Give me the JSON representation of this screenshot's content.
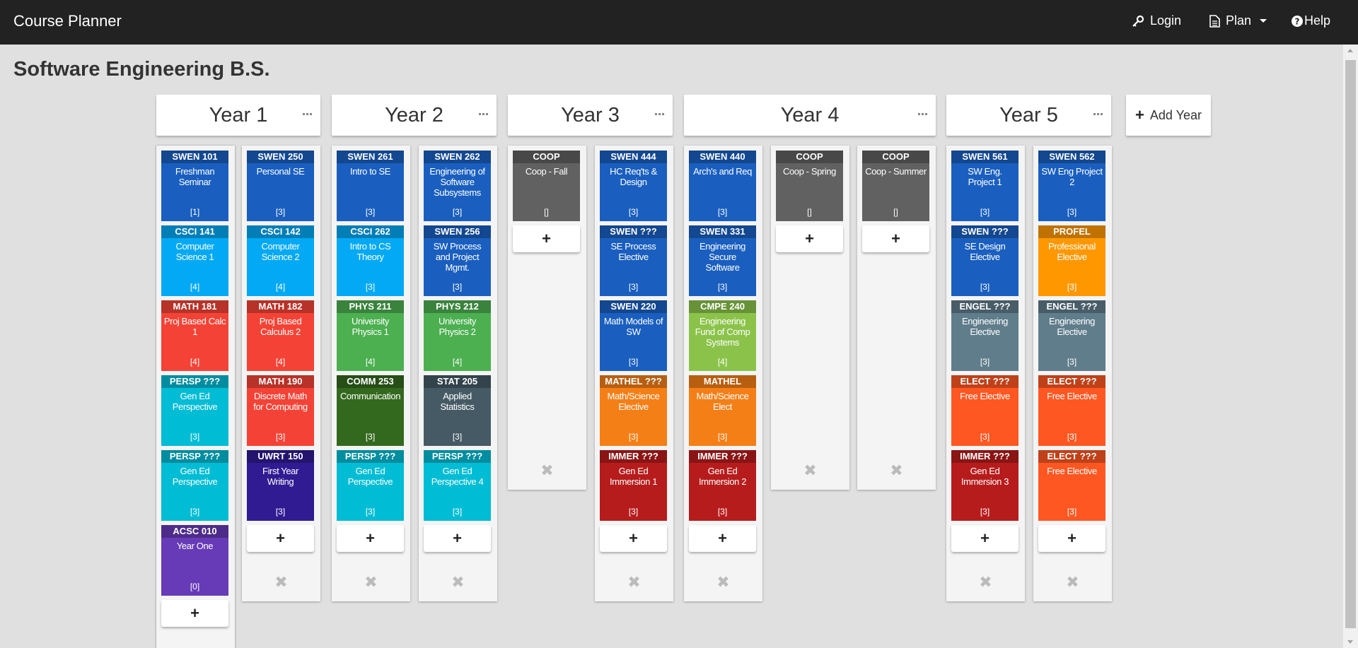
{
  "navbar": {
    "brand": "Course Planner",
    "login_label": "Login",
    "plan_label": "Plan",
    "help_label": "Help"
  },
  "page": {
    "title": "Software Engineering B.S."
  },
  "years": [
    {
      "label": "Year 1"
    },
    {
      "label": "Year 2"
    },
    {
      "label": "Year 3"
    },
    {
      "label": "Year 4"
    },
    {
      "label": "Year 5"
    }
  ],
  "add_year_label": "Add Year",
  "add_course_symbol": "+",
  "remove_symbol": "✖",
  "semesters": [
    {
      "courses": [
        {
          "code": "SWEN 101",
          "name": "Freshman Seminar",
          "credits": "[1]",
          "color": "#1a5fbf"
        },
        {
          "code": "CSCI 141",
          "name": "Computer Science 1",
          "credits": "[4]",
          "color": "#03a9f4"
        },
        {
          "code": "MATH 181",
          "name": "Proj Based Calc 1",
          "credits": "[4]",
          "color": "#f44336"
        },
        {
          "code": "PERSP ???",
          "name": "Gen Ed Perspective",
          "credits": "[3]",
          "color": "#00bcd4"
        },
        {
          "code": "PERSP ???",
          "name": "Gen Ed Perspective",
          "credits": "[3]",
          "color": "#00bcd4"
        },
        {
          "code": "ACSC 010",
          "name": "Year One",
          "credits": "[0]",
          "color": "#673ab7"
        }
      ]
    },
    {
      "courses": [
        {
          "code": "SWEN 250",
          "name": "Personal SE",
          "credits": "[3]",
          "color": "#1a5fbf"
        },
        {
          "code": "CSCI 142",
          "name": "Computer Science 2",
          "credits": "[4]",
          "color": "#03a9f4"
        },
        {
          "code": "MATH 182",
          "name": "Proj Based Calculus 2",
          "credits": "[4]",
          "color": "#f44336"
        },
        {
          "code": "MATH 190",
          "name": "Discrete Math for Computing",
          "credits": "[3]",
          "color": "#f44336"
        },
        {
          "code": "UWRT 150",
          "name": "First Year Writing",
          "credits": "[3]",
          "color": "#311b92"
        }
      ]
    },
    {
      "courses": [
        {
          "code": "SWEN 261",
          "name": "Intro to SE",
          "credits": "[3]",
          "color": "#1a5fbf"
        },
        {
          "code": "CSCI 262",
          "name": "Intro to CS Theory",
          "credits": "[3]",
          "color": "#03a9f4"
        },
        {
          "code": "PHYS 211",
          "name": "University Physics 1",
          "credits": "[4]",
          "color": "#4caf50"
        },
        {
          "code": "COMM 253",
          "name": "Communication",
          "credits": "[3]",
          "color": "#33691e"
        },
        {
          "code": "PERSP ???",
          "name": "Gen Ed Perspective",
          "credits": "[3]",
          "color": "#00bcd4"
        }
      ]
    },
    {
      "courses": [
        {
          "code": "SWEN 262",
          "name": "Engineering of Software Subsystems",
          "credits": "[3]",
          "color": "#1a5fbf"
        },
        {
          "code": "SWEN 256",
          "name": "SW Process and Project Mgmt.",
          "credits": "[3]",
          "color": "#1a5fbf"
        },
        {
          "code": "PHYS 212",
          "name": "University Physics 2",
          "credits": "[4]",
          "color": "#4caf50"
        },
        {
          "code": "STAT 205",
          "name": "Applied Statistics",
          "credits": "[3]",
          "color": "#455a64"
        },
        {
          "code": "PERSP ???",
          "name": "Gen Ed Perspective 4",
          "credits": "[3]",
          "color": "#00bcd4"
        }
      ]
    },
    {
      "courses": [
        {
          "code": "COOP",
          "name": "Coop - Fall",
          "credits": "[]",
          "color": "#616161"
        }
      ]
    },
    {
      "courses": [
        {
          "code": "SWEN 444",
          "name": "HC Req'ts & Design",
          "credits": "[3]",
          "color": "#1a5fbf"
        },
        {
          "code": "SWEN ???",
          "name": "SE Process Elective",
          "credits": "[3]",
          "color": "#1a5fbf"
        },
        {
          "code": "SWEN 220",
          "name": "Math Models of SW",
          "credits": "[3]",
          "color": "#1a5fbf"
        },
        {
          "code": "MATHEL ???",
          "name": "Math/Science Elective",
          "credits": "[3]",
          "color": "#f57f17"
        },
        {
          "code": "IMMER ???",
          "name": "Gen Ed Immersion 1",
          "credits": "[3]",
          "color": "#b71c1c"
        }
      ]
    },
    {
      "courses": [
        {
          "code": "SWEN 440",
          "name": "Arch's and Req",
          "credits": "[3]",
          "color": "#1a5fbf"
        },
        {
          "code": "SWEN 331",
          "name": "Engineering Secure Software",
          "credits": "[3]",
          "color": "#1a5fbf"
        },
        {
          "code": "CMPE 240",
          "name": "Engineering Fund of Comp Systems",
          "credits": "[4]",
          "color": "#8bc34a"
        },
        {
          "code": "MATHEL",
          "name": "Math/Science Elect",
          "credits": "[3]",
          "color": "#f57f17"
        },
        {
          "code": "IMMER ???",
          "name": "Gen Ed Immersion 2",
          "credits": "[3]",
          "color": "#b71c1c"
        }
      ]
    },
    {
      "courses": [
        {
          "code": "COOP",
          "name": "Coop - Spring",
          "credits": "[]",
          "color": "#616161"
        }
      ]
    },
    {
      "courses": [
        {
          "code": "COOP",
          "name": "Coop - Summer",
          "credits": "[]",
          "color": "#616161"
        }
      ]
    },
    {
      "courses": [
        {
          "code": "SWEN 561",
          "name": "SW Eng. Project 1",
          "credits": "[3]",
          "color": "#1a5fbf"
        },
        {
          "code": "SWEN ???",
          "name": "SE Design Elective",
          "credits": "[3]",
          "color": "#1a5fbf"
        },
        {
          "code": "ENGEL ???",
          "name": "Engineering Elective",
          "credits": "[3]",
          "color": "#607d8b"
        },
        {
          "code": "ELECT ???",
          "name": "Free Elective",
          "credits": "[3]",
          "color": "#ff5722"
        },
        {
          "code": "IMMER ???",
          "name": "Gen Ed Immersion 3",
          "credits": "[3]",
          "color": "#b71c1c"
        }
      ]
    },
    {
      "courses": [
        {
          "code": "SWEN 562",
          "name": "SW Eng Project 2",
          "credits": "[3]",
          "color": "#1a5fbf"
        },
        {
          "code": "PROFEL",
          "name": "Professional Elective",
          "credits": "[3]",
          "color": "#ff9800"
        },
        {
          "code": "ENGEL ???",
          "name": "Engineering Elective",
          "credits": "[3]",
          "color": "#607d8b"
        },
        {
          "code": "ELECT ???",
          "name": "Free Elective",
          "credits": "[3]",
          "color": "#ff5722"
        },
        {
          "code": "ELECT ???",
          "name": "Free Elective",
          "credits": "[3]",
          "color": "#ff5722"
        }
      ]
    }
  ]
}
